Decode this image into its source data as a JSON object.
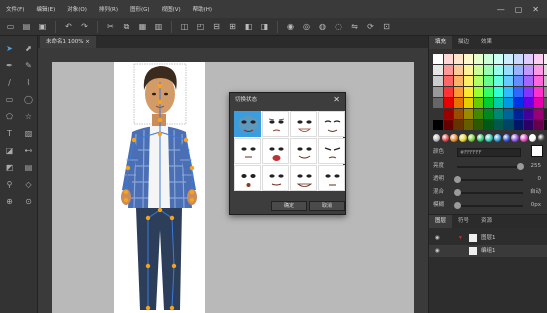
{
  "menu": {
    "items": [
      "文件(F)",
      "编辑(E)",
      "对象(O)",
      "排列(R)",
      "图形(G)",
      "视图(V)",
      "帮助(H)"
    ],
    "window_buttons": [
      "—",
      "▢",
      "✕"
    ]
  },
  "document": {
    "tab_label": "未命名1 100% ×"
  },
  "dialog": {
    "title": "切换状态",
    "ok_label": "确定",
    "cancel_label": "取消",
    "close_glyph": "✕"
  },
  "right_panel": {
    "tabs": [
      "填充",
      "描边",
      "效果"
    ],
    "color_label": "颜色",
    "hex_value": "#FFFFFF",
    "rows": [
      {
        "label": "亮度",
        "value": "255",
        "level": 0.95
      },
      {
        "label": "透明",
        "value": "0",
        "level": 0.0
      },
      {
        "label": "混合",
        "value": "自动",
        "level": 0.0
      },
      {
        "label": "模糊",
        "value": "0px",
        "level": 0.0
      }
    ],
    "layer_tabs": [
      "图层",
      "符号",
      "资源"
    ],
    "layers": [
      {
        "name": "图层1"
      },
      {
        "name": "编组1"
      }
    ]
  },
  "colors": {
    "accent": "#3b9ddd",
    "swatches": [
      [
        "#ffffff",
        "#ffd7d7",
        "#ffe6cc",
        "#fff9cc",
        "#e6ffcc",
        "#ccffd9",
        "#ccfff5",
        "#cceeff",
        "#ccd9ff",
        "#e0ccff",
        "#ffccf2",
        "#f2f2f2"
      ],
      [
        "#e6e6e6",
        "#ff9999",
        "#ffcc99",
        "#fff399",
        "#ccff99",
        "#99ffb3",
        "#99ffeb",
        "#99ddff",
        "#99b3ff",
        "#c299ff",
        "#ff99e6",
        "#d9d9d9"
      ],
      [
        "#cccccc",
        "#ff6666",
        "#ffb366",
        "#ffee66",
        "#b3ff66",
        "#66ff8c",
        "#66ffe0",
        "#66ccff",
        "#668cff",
        "#a366ff",
        "#ff66d9",
        "#bfbfbf"
      ],
      [
        "#999999",
        "#ff3333",
        "#ff9933",
        "#ffe833",
        "#99ff33",
        "#33ff66",
        "#33ffd6",
        "#33bbff",
        "#3366ff",
        "#8533ff",
        "#ff33cc",
        "#8c8c8c"
      ],
      [
        "#666666",
        "#e60000",
        "#e67300",
        "#e6cf00",
        "#66cc00",
        "#00cc33",
        "#00ccaa",
        "#0099e6",
        "#0033e6",
        "#6600e6",
        "#e600ac",
        "#595959"
      ],
      [
        "#333333",
        "#990000",
        "#994d00",
        "#998a00",
        "#448800",
        "#008822",
        "#008872",
        "#006699",
        "#002299",
        "#440099",
        "#990073",
        "#262626"
      ],
      [
        "#000000",
        "#660000",
        "#663300",
        "#665c00",
        "#2d5900",
        "#005916",
        "#00594b",
        "#004466",
        "#001666",
        "#2d0066",
        "#66004d",
        "#111111"
      ]
    ],
    "balls": [
      "#bbbbbb",
      "#e04848",
      "#e58a2c",
      "#e5d22c",
      "#7ccf38",
      "#2fc86a",
      "#2fc8b5",
      "#2f9ee0",
      "#3a55d9",
      "#8a4fe0",
      "#d949b8",
      "#ffffff",
      "#444444"
    ]
  }
}
